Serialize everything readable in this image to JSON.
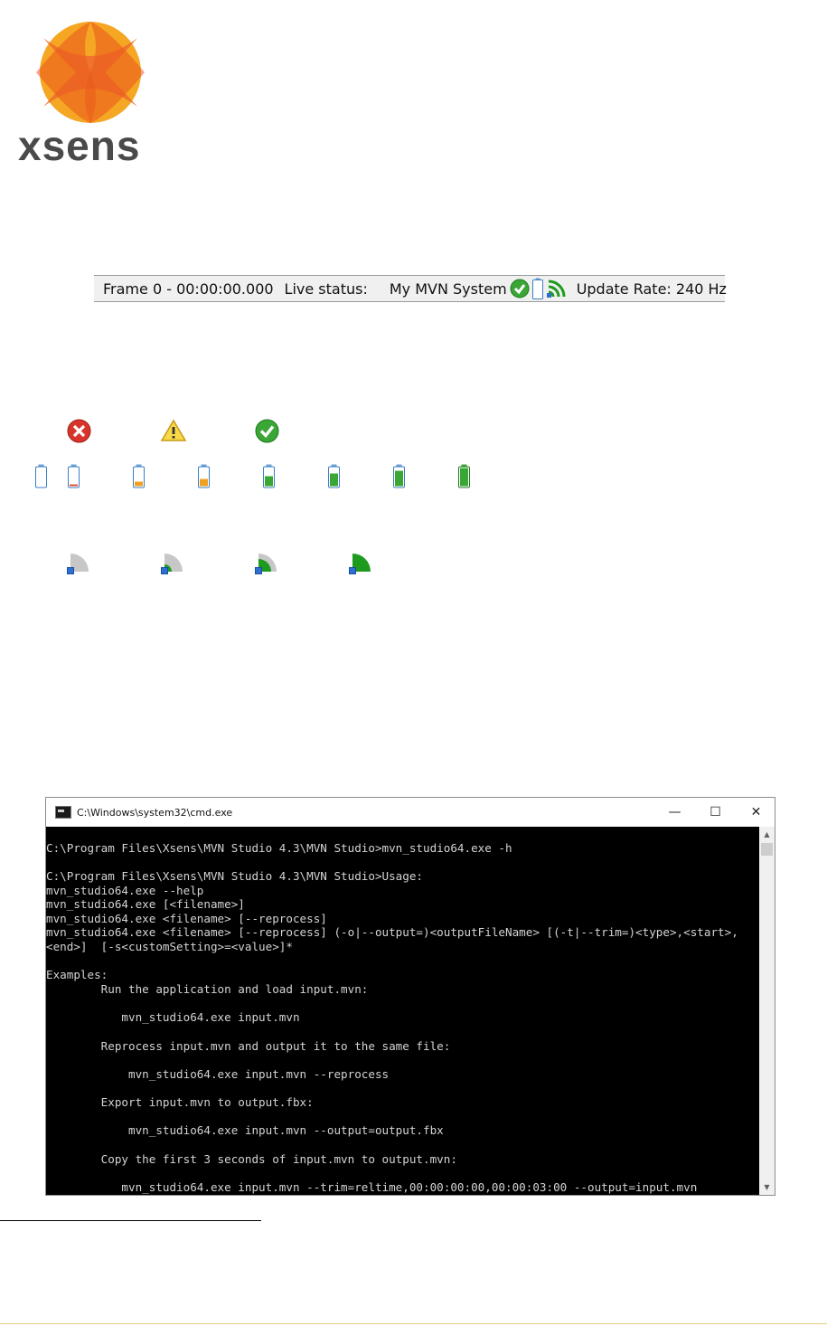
{
  "brand": {
    "name": "xsens",
    "colors": {
      "orange": "#f5a623",
      "red": "#e94e1b",
      "gray": "#4a4a4a"
    }
  },
  "statusbar": {
    "frame": "Frame 0 - 00:00:00.000",
    "live_status_label": "Live status:",
    "system_name": "My MVN System",
    "update_rate": "Update Rate: 240 Hz",
    "icons": [
      "check-icon",
      "battery-icon",
      "signal-icon"
    ]
  },
  "status_icons": [
    "error-icon",
    "warning-icon",
    "ok-icon"
  ],
  "battery_levels": [
    0,
    0.1,
    0.25,
    0.4,
    0.55,
    0.7,
    0.85,
    1.0
  ],
  "signal_levels": [
    0,
    1,
    2,
    3
  ],
  "terminal": {
    "title": "C:\\Windows\\system32\\cmd.exe",
    "buttons": {
      "minimize": "—",
      "maximize": "☐",
      "close": "✕"
    },
    "lines": [
      "",
      "C:\\Program Files\\Xsens\\MVN Studio 4.3\\MVN Studio>mvn_studio64.exe -h",
      "",
      "C:\\Program Files\\Xsens\\MVN Studio 4.3\\MVN Studio>Usage:",
      "mvn_studio64.exe --help",
      "mvn_studio64.exe [<filename>]",
      "mvn_studio64.exe <filename> [--reprocess]",
      "mvn_studio64.exe <filename> [--reprocess] (-o|--output=)<outputFileName> [(-t|--trim=)<type>,<start>,",
      "<end>]  [-s<customSetting>=<value>]*",
      "",
      "Examples:",
      "        Run the application and load input.mvn:",
      "",
      "           mvn_studio64.exe input.mvn",
      "",
      "        Reprocess input.mvn and output it to the same file:",
      "",
      "            mvn_studio64.exe input.mvn --reprocess",
      "",
      "        Export input.mvn to output.fbx:",
      "",
      "            mvn_studio64.exe input.mvn --output=output.fbx",
      "",
      "        Copy the first 3 seconds of input.mvn to output.mvn:",
      "",
      "           mvn_studio64.exe input.mvn --trim=reltime,00:00:00:00,00:00:03:00 --output=input.mvn"
    ]
  }
}
